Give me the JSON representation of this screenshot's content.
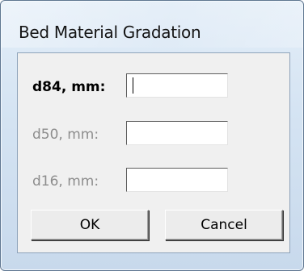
{
  "dialog": {
    "title": "Bed Material Gradation"
  },
  "fields": [
    {
      "label": "d84, mm:",
      "value": "",
      "state": "active"
    },
    {
      "label": "d50, mm:",
      "value": "",
      "state": "disabled"
    },
    {
      "label": "d16, mm:",
      "value": "",
      "state": "disabled"
    }
  ],
  "buttons": {
    "ok_label": "OK",
    "cancel_label": "Cancel"
  }
}
